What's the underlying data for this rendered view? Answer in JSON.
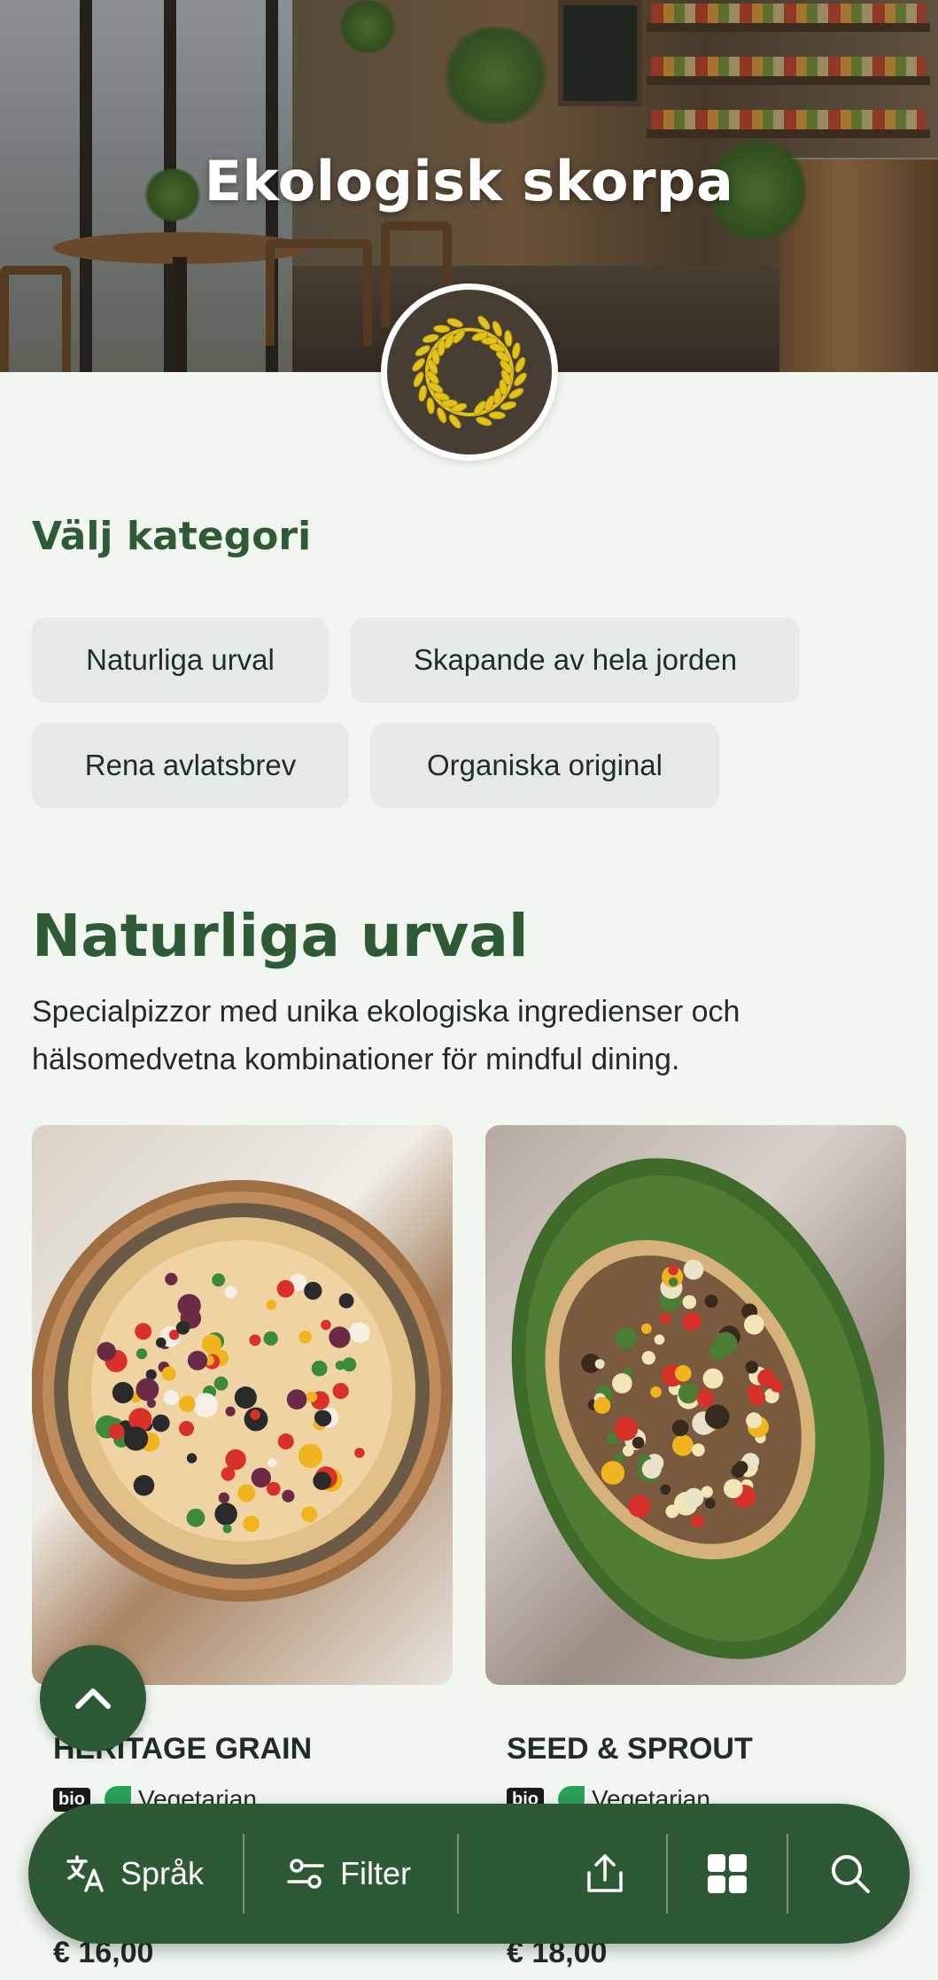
{
  "hero": {
    "title": "Ekologisk skorpa"
  },
  "category_picker": {
    "heading": "Välj kategori",
    "chips": [
      {
        "label": "Naturliga urval"
      },
      {
        "label": "Skapande av hela jorden"
      },
      {
        "label": "Rena avlatsbrev"
      },
      {
        "label": "Organiska original"
      }
    ]
  },
  "section": {
    "title": "Naturliga urval",
    "description": "Specialpizzor med unika ekologiska ingredienser och hälsomedvetna kombinationer för mindful dining."
  },
  "products": [
    {
      "name": "HERITAGE GRAIN",
      "badge": "bio",
      "diet": "Vegetarian",
      "price": "€ 16,00"
    },
    {
      "name": "SEED & SPROUT",
      "badge": "bio",
      "diet": "Vegetarian",
      "price": "€ 18,00"
    }
  ],
  "bottom_bar": {
    "language_label": "Språk",
    "filter_label": "Filter",
    "icons": [
      "translate-icon",
      "filter-icon",
      "share-icon",
      "grid-icon",
      "search-icon"
    ]
  },
  "colors": {
    "brand_green": "#2d5a35",
    "background": "#f1f6f0",
    "chip_bg": "#e4ebe3",
    "logo_bg": "#463d33",
    "laurel_gold": "#e3c21a"
  }
}
